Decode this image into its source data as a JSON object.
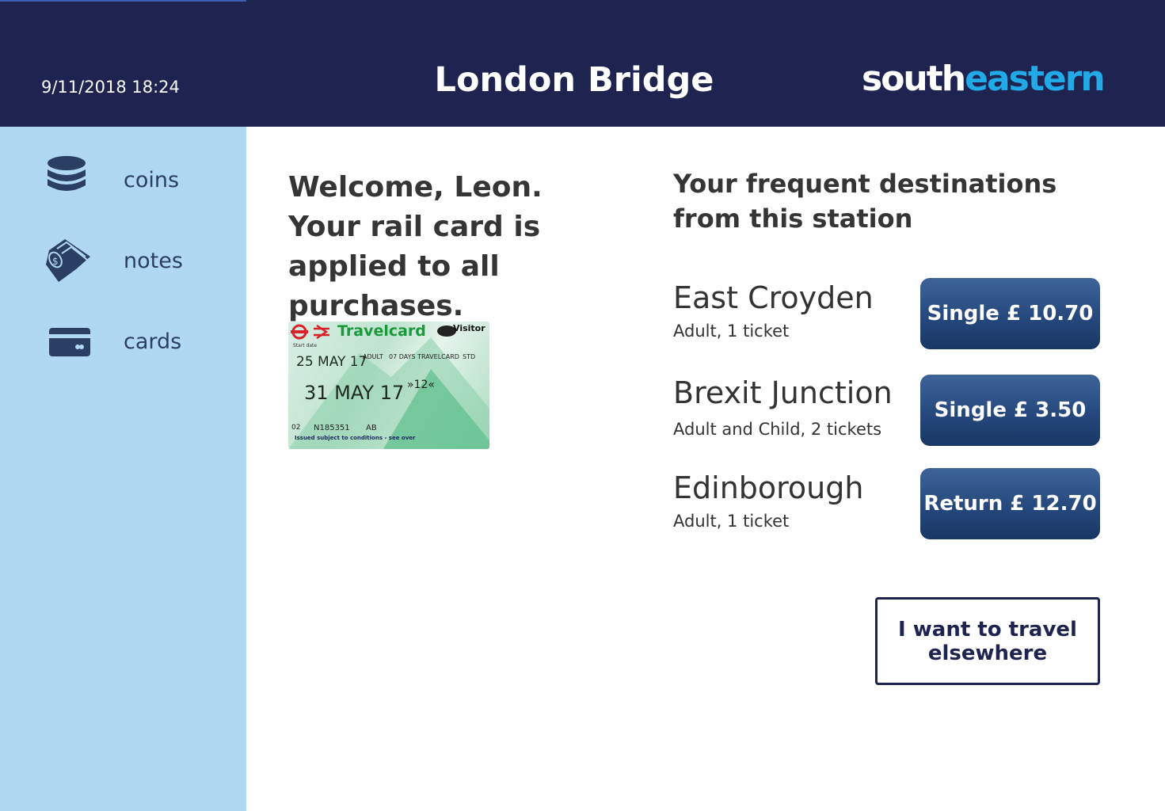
{
  "header": {
    "datetime": "9/11/2018 18:24",
    "station": "London Bridge",
    "brand_part1": "south",
    "brand_part2": "eastern",
    "background_color": "#1e2350",
    "brand_accent_color": "#22a9e8"
  },
  "sidebar": {
    "background_color": "#b0d8f3",
    "items": [
      {
        "label": "coins",
        "icon": "coins-icon"
      },
      {
        "label": "notes",
        "icon": "banknotes-icon"
      },
      {
        "label": "cards",
        "icon": "credit-card-icon"
      }
    ]
  },
  "main": {
    "welcome": "Welcome, Leon. Your rail card is applied to all purchases.",
    "travelcard": {
      "title": "Travelcard",
      "badge": "Visitor",
      "start_label": "Start date",
      "start_date": "25 MAY 17",
      "status": "ADULT",
      "ticket_type": "07 DAYS TRAVELCARD",
      "class": "STD",
      "expiry_date": "31 MAY 17",
      "zones": "»12«",
      "number": "02",
      "code_value": "N185351",
      "code": "AB",
      "footer": "Issued subject to conditions - see over"
    },
    "frequent_title": "Your frequent destinations from this station",
    "destinations": [
      {
        "name": "East Croyden",
        "details": "Adult, 1 ticket",
        "button": "Single £ 10.70"
      },
      {
        "name": "Brexit Junction",
        "details": "Adult and Child, 2 tickets",
        "button": "Single £ 3.50"
      },
      {
        "name": "Edinborough",
        "details": "Adult, 1 ticket",
        "button": "Return £ 12.70"
      }
    ],
    "elsewhere_button": "I want to travel elsewhere"
  }
}
